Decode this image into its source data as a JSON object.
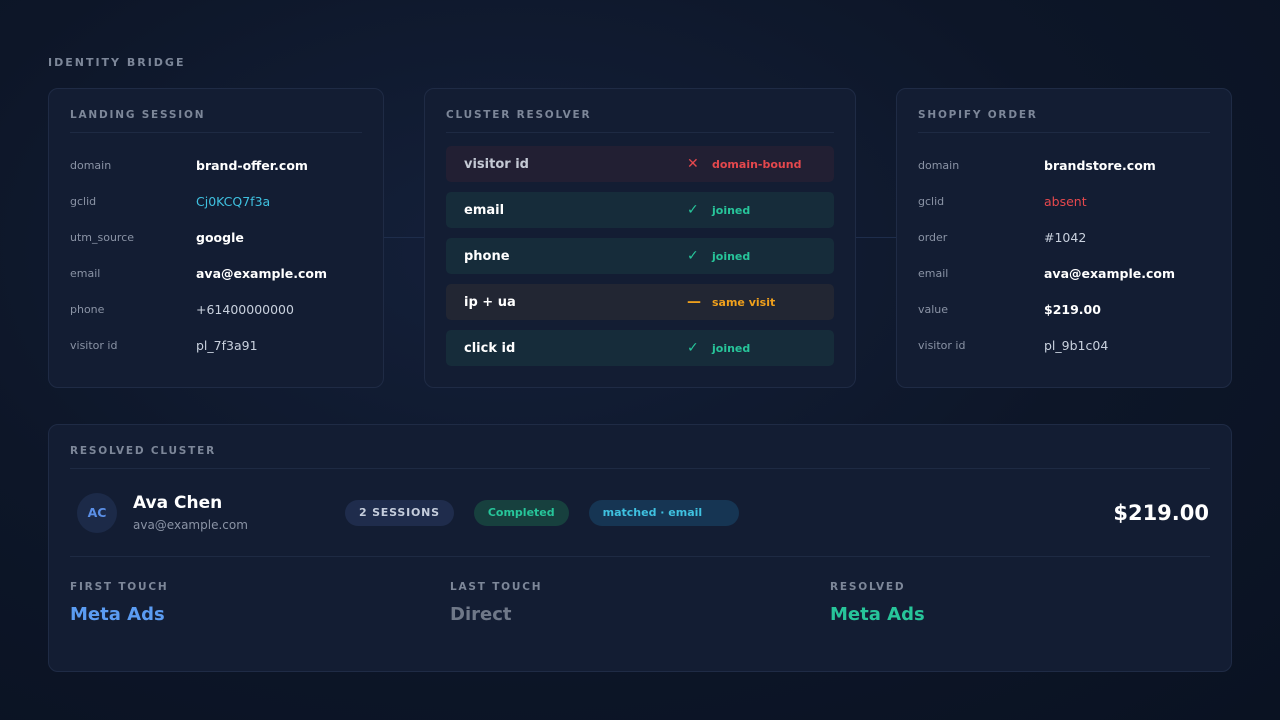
{
  "page_title": "IDENTITY BRIDGE",
  "landing": {
    "title": "LANDING SESSION",
    "rows": [
      {
        "key": "domain",
        "value": "brand-offer.com"
      },
      {
        "key": "gclid",
        "value": "Cj0KCQ7f3a"
      },
      {
        "key": "utm_source",
        "value": "google"
      },
      {
        "key": "email",
        "value": "ava@example.com"
      },
      {
        "key": "phone",
        "value": "+61400000000"
      },
      {
        "key": "visitor id",
        "value": "pl_7f3a91"
      }
    ]
  },
  "resolver": {
    "title": "CLUSTER RESOLVER",
    "rows": [
      {
        "label": "visitor id",
        "icon": "x-icon",
        "glyph": "✕",
        "status": "domain-bound"
      },
      {
        "label": "email",
        "icon": "check-icon",
        "glyph": "✓",
        "status": "joined"
      },
      {
        "label": "phone",
        "icon": "check-icon",
        "glyph": "✓",
        "status": "joined"
      },
      {
        "label": "ip + ua",
        "icon": "dash-icon",
        "glyph": "—",
        "status": "same visit"
      },
      {
        "label": "click id",
        "icon": "check-icon",
        "glyph": "✓",
        "status": "joined"
      }
    ]
  },
  "shopify": {
    "title": "SHOPIFY ORDER",
    "rows": [
      {
        "key": "domain",
        "value": "brandstore.com"
      },
      {
        "key": "gclid",
        "value": "absent"
      },
      {
        "key": "order",
        "value": "#1042"
      },
      {
        "key": "email",
        "value": "ava@example.com"
      },
      {
        "key": "value",
        "value": "$219.00"
      },
      {
        "key": "visitor id",
        "value": "pl_9b1c04"
      }
    ]
  },
  "cluster": {
    "title": "RESOLVED CLUSTER",
    "initials": "AC",
    "name": "Ava Chen",
    "email": "ava@example.com",
    "sessions_pill": "2 SESSIONS",
    "status_pill": "Completed",
    "match_pill": "matched · email",
    "total": "$219.00",
    "first_touch": {
      "label": "FIRST TOUCH",
      "value": "Meta Ads"
    },
    "last_touch": {
      "label": "LAST TOUCH",
      "value": "Direct"
    },
    "resolved": {
      "label": "RESOLVED",
      "value": "Meta Ads"
    }
  },
  "colors": {
    "background": "#0d1628",
    "panel": "#131d33",
    "success": "#27c59a",
    "error": "#e5484d",
    "warning": "#f0a01c",
    "link": "#3fc1e0",
    "accent_blue": "#5b9cf2"
  }
}
